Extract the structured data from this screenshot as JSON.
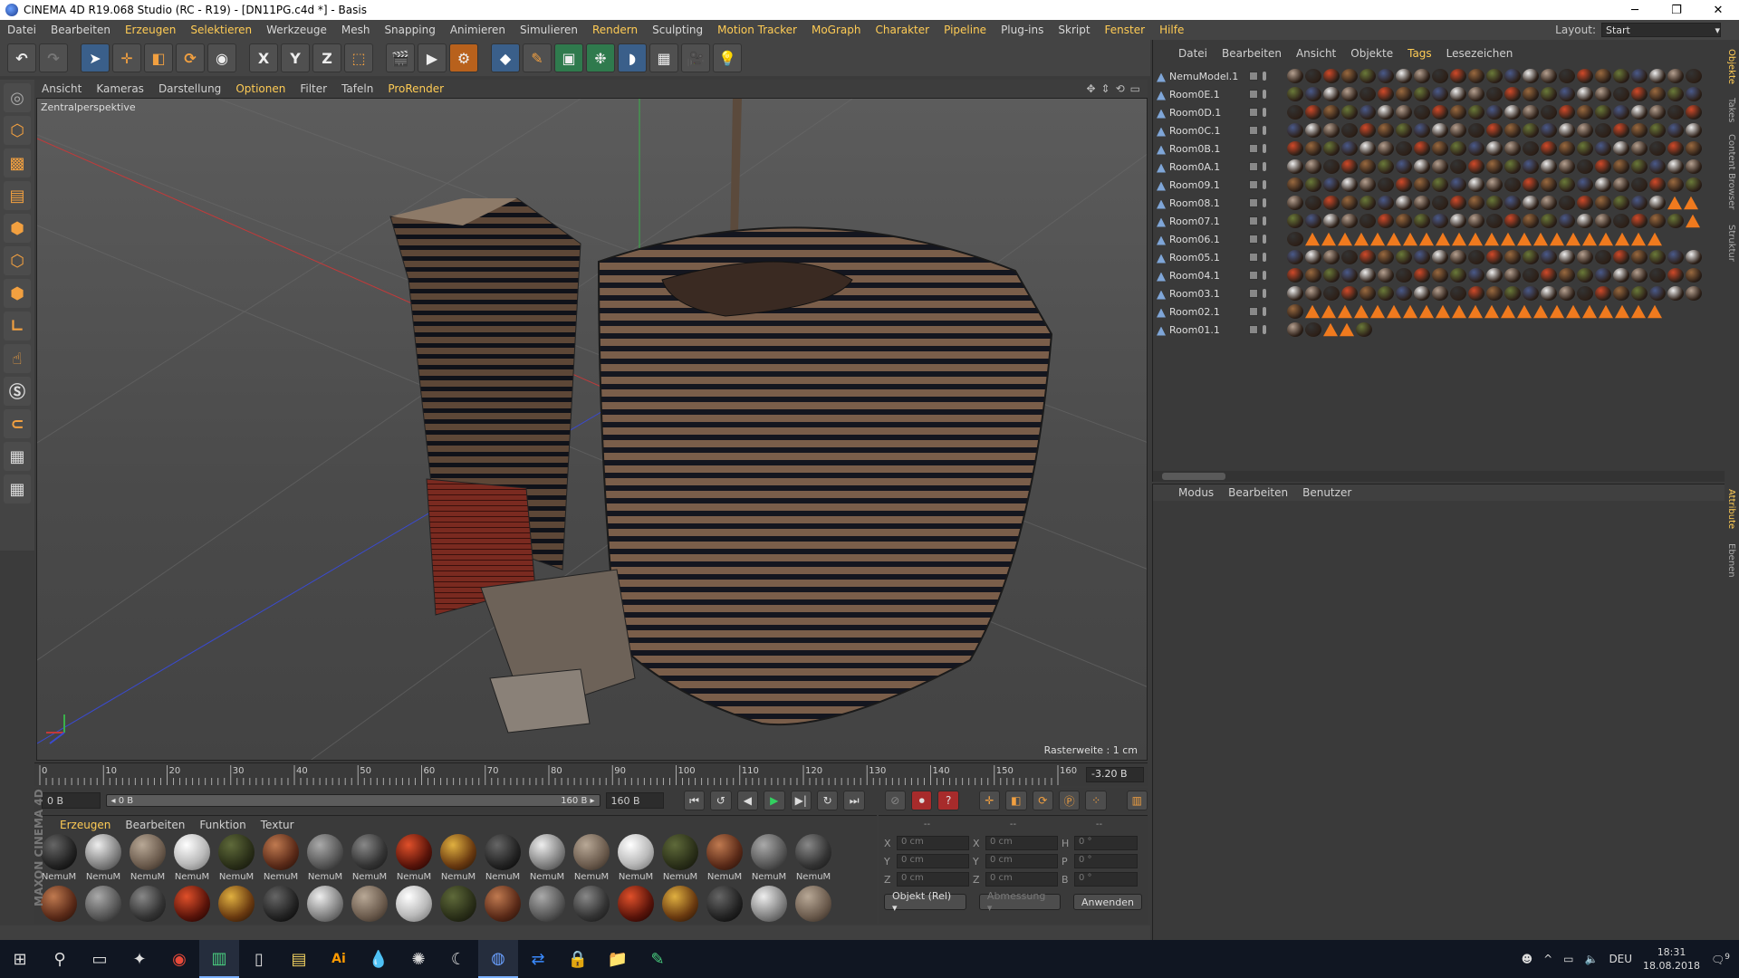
{
  "window": {
    "title": "CINEMA 4D R19.068 Studio (RC - R19) - [DN11PG.c4d *] - Basis",
    "min": "─",
    "max": "❐",
    "close": "✕"
  },
  "menubar": {
    "items": [
      "Datei",
      "Bearbeiten",
      "Erzeugen",
      "Selektieren",
      "Werkzeuge",
      "Mesh",
      "Snapping",
      "Animieren",
      "Simulieren",
      "Rendern",
      "Sculpting",
      "Motion Tracker",
      "MoGraph",
      "Charakter",
      "Pipeline",
      "Plug-ins",
      "Skript",
      "Fenster",
      "Hilfe"
    ],
    "layout_label": "Layout:",
    "layout_value": "Start"
  },
  "viewport": {
    "menu": [
      "Ansicht",
      "Kameras",
      "Darstellung",
      "Optionen",
      "Filter",
      "Tafeln",
      "ProRender"
    ],
    "camera": "Zentralperspektive",
    "grid_label": "Rasterweite : 1 cm"
  },
  "timeline": {
    "ticks": [
      "0",
      "10",
      "20",
      "30",
      "40",
      "50",
      "60",
      "70",
      "80",
      "90",
      "100",
      "110",
      "120",
      "130",
      "140",
      "150",
      "160"
    ],
    "current": "-3.20 B",
    "start_field": "0 B",
    "slider_left": "◂ 0 B",
    "slider_right": "160 B ▸",
    "end_field": "160 B"
  },
  "material_manager": {
    "menu": [
      "Erzeugen",
      "Bearbeiten",
      "Funktion",
      "Textur"
    ],
    "label": "NemuM",
    "brand": "MAXON CINEMA 4D"
  },
  "coords": {
    "headers": [
      "--",
      "--",
      "--"
    ],
    "rows": [
      {
        "a": "X",
        "v1": "0 cm",
        "b": "X",
        "v2": "0 cm",
        "c": "H",
        "v3": "0 °"
      },
      {
        "a": "Y",
        "v1": "0 cm",
        "b": "Y",
        "v2": "0 cm",
        "c": "P",
        "v3": "0 °"
      },
      {
        "a": "Z",
        "v1": "0 cm",
        "b": "Z",
        "v2": "0 cm",
        "c": "B",
        "v3": "0 °"
      }
    ],
    "mode": "Objekt (Rel) ▾",
    "dim": "Abmessung ▾",
    "apply": "Anwenden"
  },
  "object_manager": {
    "menu": [
      "Datei",
      "Bearbeiten",
      "Ansicht",
      "Objekte",
      "Tags",
      "Lesezeichen"
    ],
    "objects": [
      "NemuModel.1",
      "Room0E.1",
      "Room0D.1",
      "Room0C.1",
      "Room0B.1",
      "Room0A.1",
      "Room09.1",
      "Room08.1",
      "Room07.1",
      "Room06.1",
      "Room05.1",
      "Room04.1",
      "Room03.1",
      "Room02.1",
      "Room01.1"
    ]
  },
  "attribute_manager": {
    "menu": [
      "Modus",
      "Bearbeiten",
      "Benutzer"
    ]
  },
  "right_tabs": [
    "Objekte",
    "Takes",
    "Content Browser",
    "Struktur",
    "Attribute",
    "Ebenen"
  ],
  "taskbar": {
    "lang": "DEU",
    "time": "18:31",
    "date": "18.08.2018",
    "notif": "9"
  },
  "colors": {
    "accent_orange": "#f07a1e",
    "highlight_menu": "#ffcc55",
    "axis_x": "#c23a3a",
    "axis_y": "#3ab04a",
    "axis_z": "#3a4ad0"
  }
}
